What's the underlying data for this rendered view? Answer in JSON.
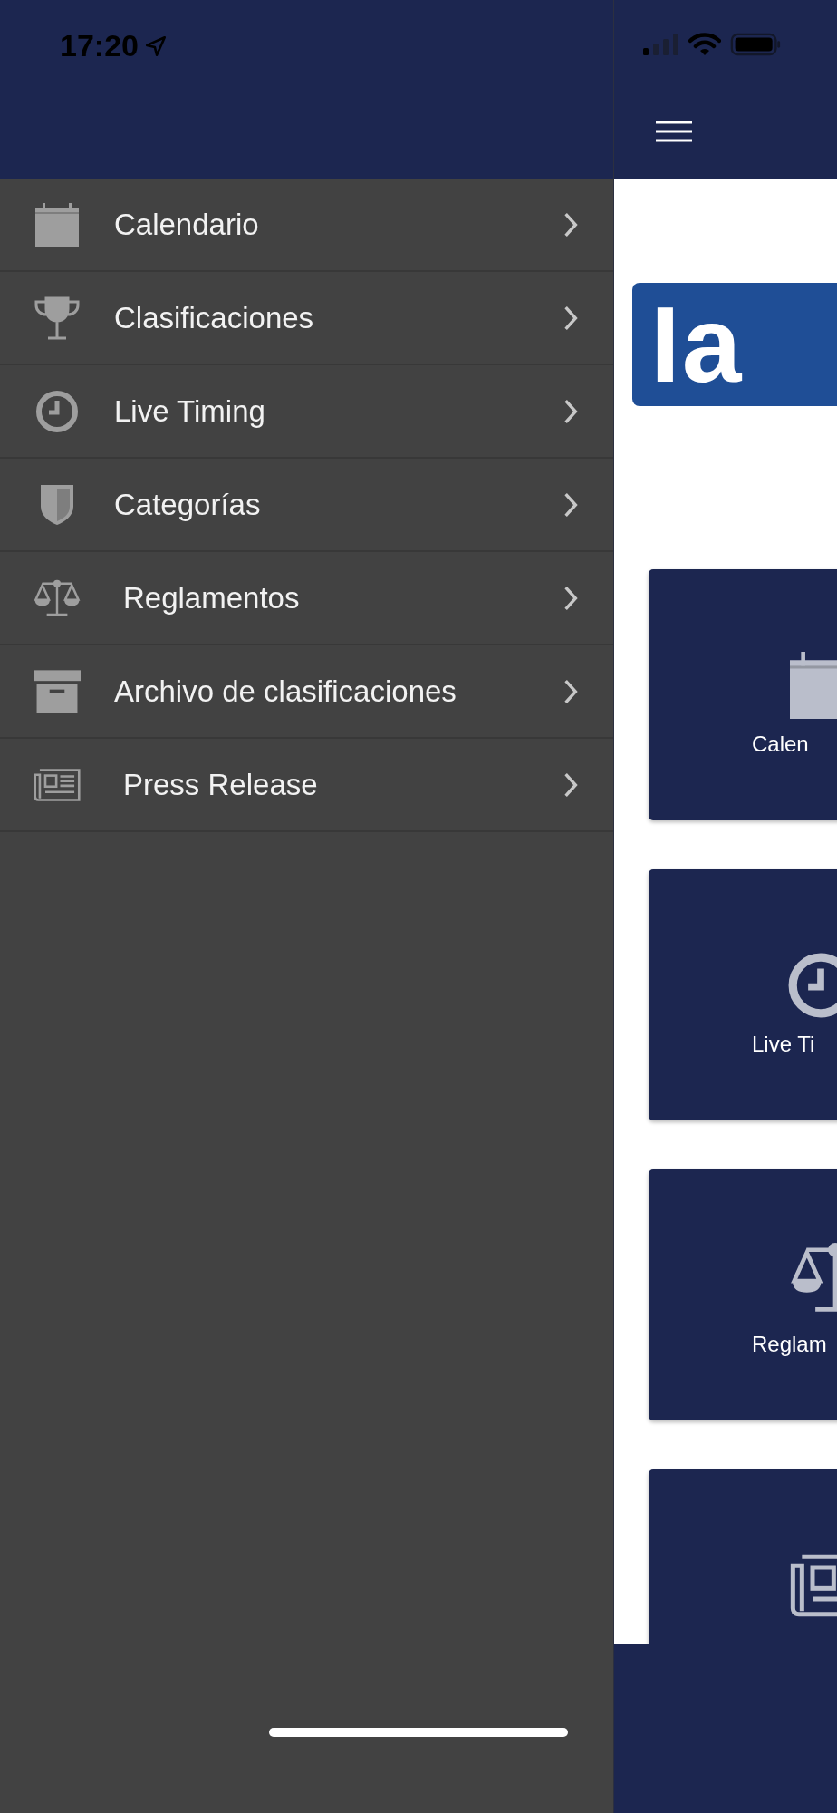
{
  "status_bar": {
    "time": "17:20"
  },
  "drawer": {
    "items": [
      {
        "label": "Calendario"
      },
      {
        "label": "Clasificaciones"
      },
      {
        "label": "Live Timing"
      },
      {
        "label": "Categorías"
      },
      {
        "label": "Reglamentos"
      },
      {
        "label": "Archivo de clasificaciones"
      },
      {
        "label": "Press Release"
      }
    ]
  },
  "main": {
    "logo_text": "Ia",
    "cards": [
      {
        "kind": "full",
        "label": "Calen"
      },
      {
        "kind": "full",
        "label": "Live Ti"
      },
      {
        "kind": "full",
        "label": "Reglam"
      },
      {
        "kind": "cut"
      }
    ]
  }
}
